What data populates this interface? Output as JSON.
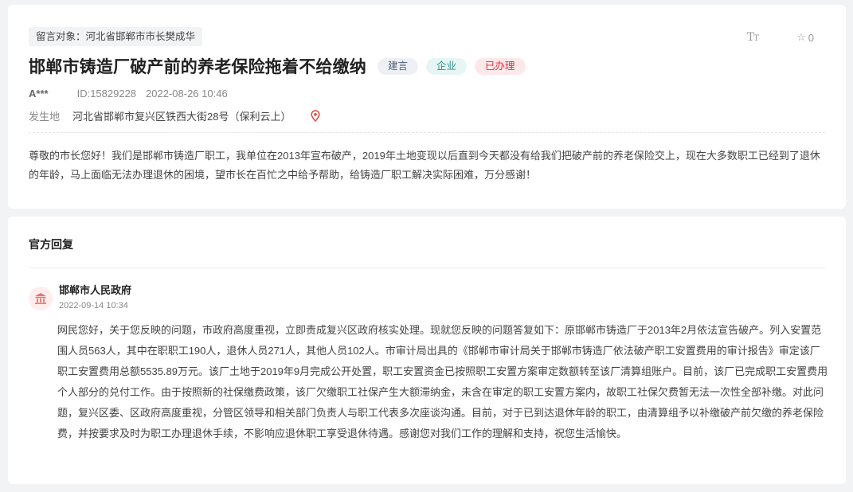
{
  "message": {
    "target": "留言对象：河北省邯郸市市长樊成华",
    "title": "邯郸市铸造厂破产前的养老保险拖着不给缴纳",
    "tags": {
      "type": "建言",
      "category": "企业",
      "status": "已办理"
    },
    "author": "A***",
    "id": "ID:15829228",
    "datetime": "2022-08-26 10:46",
    "location_label": "发生地",
    "location": "河北省邯郸市复兴区铁西大街28号（保利云上）",
    "content": "尊敬的市长您好！我们是邯郸市铸造厂职工，我单位在2013年宣布破产，2019年土地变现以后直到今天都没有给我们把破产前的养老保险交上，现在大多数职工已经到了退休的年龄，马上面临无法办理退休的困境，望市长在百忙之中给予帮助，给铸造厂职工解决实际困难，万分感谢！"
  },
  "toolbar": {
    "font_size_icon": "font-size-icon",
    "star_icon": "star-icon",
    "star_count": "0"
  },
  "reply": {
    "heading": "官方回复",
    "org_name": "邯郸市人民政府",
    "org_icon": "government-building-icon",
    "date": "2022-09-14 10:34",
    "text": "网民您好，关于您反映的问题，市政府高度重视，立即责成复兴区政府核实处理。现就您反映的问题答复如下：原邯郸市铸造厂于2013年2月依法宣告破产。列入安置范围人员563人，其中在职职工190人，退休人员271人，其他人员102人。市审计局出具的《邯郸市审计局关于邯郸市铸造厂依法破产职工安置费用的审计报告》审定该厂职工安置费用总额5535.89万元。该厂土地于2019年9月完成公开处置，职工安置资金已按照职工安置方案审定数额转至该厂清算组账户。目前，该厂已完成职工安置费用个人部分的兑付工作。由于按照新的社保缴费政策，该厂欠缴职工社保产生大额滞纳金，未含在审定的职工安置方案内，故职工社保欠费暂无法一次性全部补缴。对此问题，复兴区委、区政府高度重视，分管区领导和相关部门负责人与职工代表多次座谈沟通。目前，对于已到达退休年龄的职工，由清算组予以补缴破产前欠缴的养老保险费，并按要求及时为职工办理退休手续，不影响应退休职工享受退休待遇。感谢您对我们工作的理解和支持，祝您生活愉快。"
  },
  "colors": {
    "page_bg": "#f2f3f5",
    "status_red": "#d7303f",
    "category_teal": "#2f8f8a",
    "pin_red": "#e0473f"
  }
}
